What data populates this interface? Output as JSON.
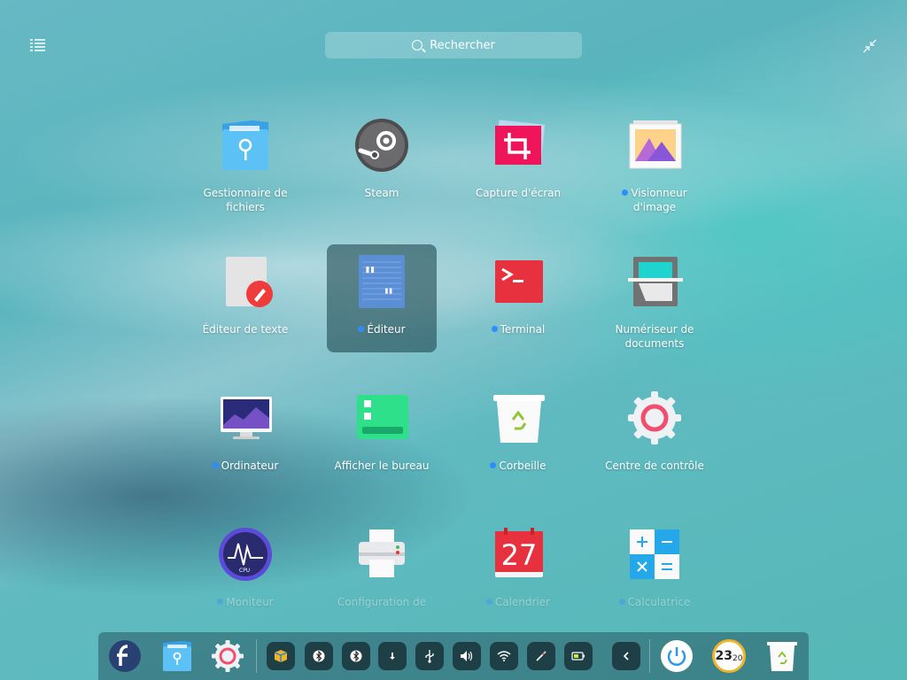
{
  "search": {
    "label": "Rechercher"
  },
  "apps": [
    {
      "label": "Gestionnaire de fichiers",
      "dot": false,
      "icon": "file-manager-icon"
    },
    {
      "label": "Steam",
      "dot": false,
      "icon": "steam-icon"
    },
    {
      "label": "Capture d'écran",
      "dot": false,
      "icon": "screenshot-icon"
    },
    {
      "label": "Visionneur d'image",
      "dot": true,
      "icon": "image-viewer-icon"
    },
    {
      "label": "Éditeur de texte",
      "dot": false,
      "icon": "text-editor-icon"
    },
    {
      "label": "Éditeur",
      "dot": true,
      "icon": "editor-icon"
    },
    {
      "label": "Terminal",
      "dot": true,
      "icon": "terminal-icon"
    },
    {
      "label": "Numériseur de documents",
      "dot": false,
      "icon": "scanner-icon"
    },
    {
      "label": "Ordinateur",
      "dot": true,
      "icon": "computer-icon"
    },
    {
      "label": "Afficher le bureau",
      "dot": false,
      "icon": "show-desktop-icon"
    },
    {
      "label": "Corbeille",
      "dot": true,
      "icon": "trash-icon"
    },
    {
      "label": "Centre de contrôle",
      "dot": false,
      "icon": "control-center-icon"
    },
    {
      "label": "Moniteur",
      "dot": true,
      "icon": "system-monitor-icon"
    },
    {
      "label": "Configuration de",
      "dot": false,
      "icon": "printer-icon"
    },
    {
      "label": "Calendrier",
      "dot": true,
      "icon": "calendar-icon"
    },
    {
      "label": "Calculatrice",
      "dot": true,
      "icon": "calculator-icon"
    }
  ],
  "calendar_day": "27",
  "clock": {
    "hour": "23",
    "minute": "20"
  },
  "colors": {
    "accent": "#2f8cff",
    "selected_bg": "#1f4a52"
  }
}
